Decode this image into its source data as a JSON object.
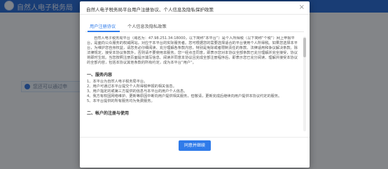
{
  "background": {
    "site_title": "自然人电子税务局",
    "notice": "您还可以通过申"
  },
  "modal": {
    "title": "自然人电子税务局平台用户注册协议、个人信息及隐私保护政策",
    "close_symbol": "×",
    "tabs": [
      {
        "label": "用户注册协议",
        "active": true
      },
      {
        "label": "个人信息及隐私政策",
        "active": false
      }
    ],
    "intro": "自然人电子税务局平台（域名为：47.98.251.34:18000，以下简称“本平台”）是个人所得税（以下简称“个税”）网上申报平台，是面向公众服务的权威网站，对应于本平台的实际服务者。您可根据您的需要选择适合的平台使用个人所得税。如果您选择本平台，为维护您自身权益，请您务必仔细阅读、充分理解各条款内容，特别是免除或者限制责任的条款、法律适用和争议解决条款。除法律规定，接受本协议条款外，否则请不要使用本服务。您一经点击同意，即表示您对本协议全部条款已充分理解并完全接受，协议将即时生效。当您按照注册页面提示填写信息、阅读并同意本协议且完成全部注册程序后，即表示您已充分阅读、理解并接受本协议的全部内容，包括本协议其他条款的所有约定，成为本平台“用户”。",
    "sections": [
      {
        "title": "一、服务内容",
        "items": [
          "1、本平台为自然人电子税务局平台。",
          "2、用户可通过本平台提交个人所得税申报的相关信息。",
          "3、用户指定的或第三方提供的信息与本平台的用户个人信息。",
          "4、我方有权因网络维护、更新等原因中断向用户提供相关服务，但敬请，更新完成后继续向用户提供本协议约定的服务。",
          "5、本平台提供的所有服务均为免费服务。"
        ]
      },
      {
        "title": "二、帐户的注册与使用",
        "items": []
      }
    ],
    "agree_button": "同意并继续"
  }
}
